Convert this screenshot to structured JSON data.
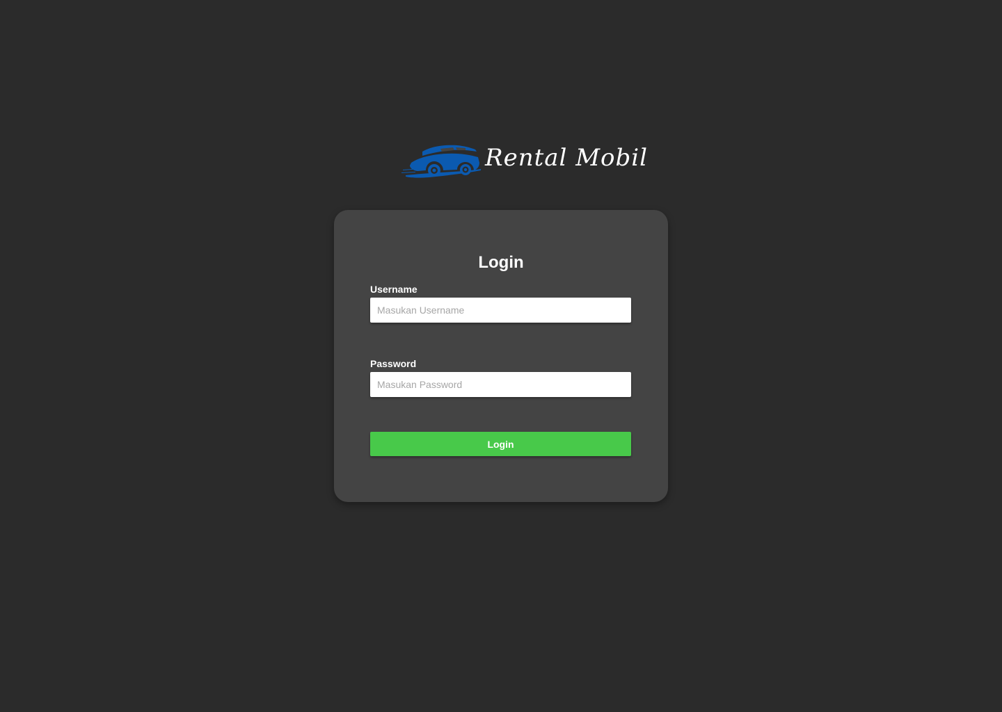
{
  "brand": {
    "name": "Rental Mobil",
    "logo_icon": "car-icon",
    "logo_color": "#0b5ab0"
  },
  "login_form": {
    "title": "Login",
    "username": {
      "label": "Username",
      "value": "",
      "placeholder": "Masukan Username"
    },
    "password": {
      "label": "Password",
      "value": "",
      "placeholder": "Masukan Password"
    },
    "submit_label": "Login",
    "submit_color": "#48c94a"
  },
  "colors": {
    "background": "#2b2b2b",
    "card": "#444444"
  }
}
